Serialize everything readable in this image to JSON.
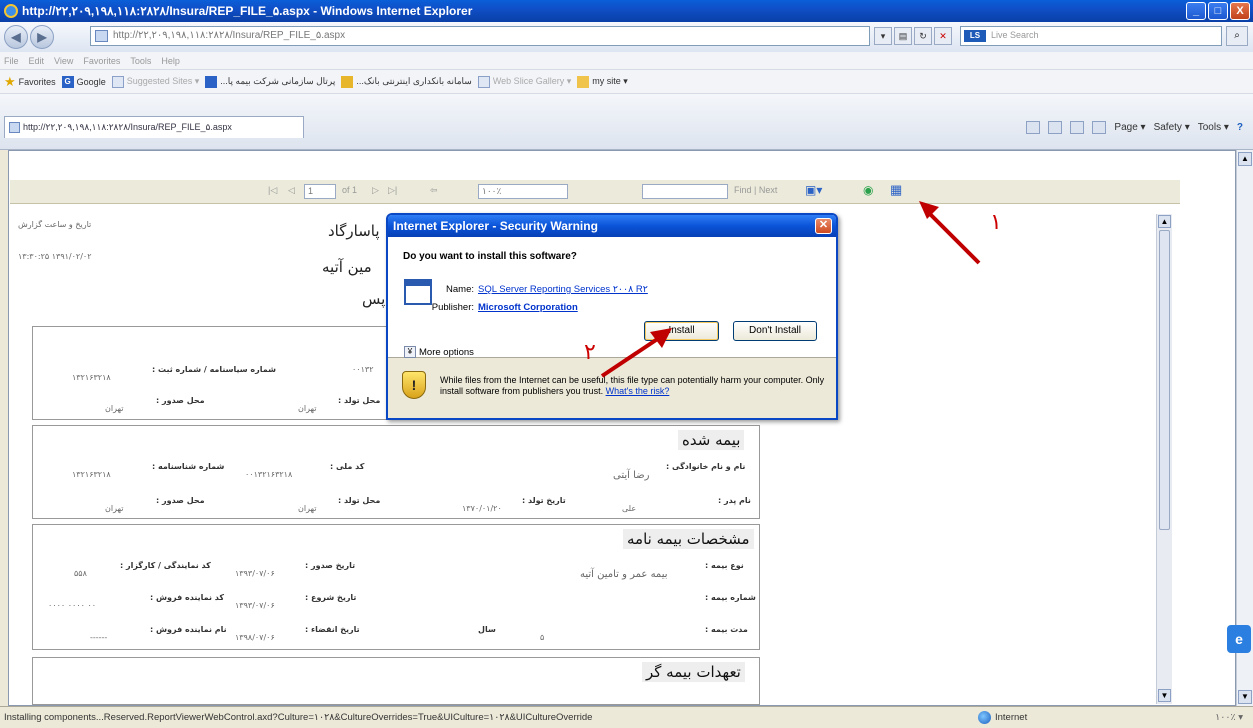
{
  "window": {
    "title": "http://۲۲,۲۰۹,۱۹۸,۱۱۸:۲۸۲۸/Insura/REP_FILE_۵.aspx - Windows Internet Explorer",
    "minimize": "_",
    "maximize": "□",
    "close": "X"
  },
  "address": {
    "url": "http://۲۲,۲۰۹,۱۹۸,۱۱۸:۲۸۲۸/Insura/REP_FILE_۵.aspx",
    "search_placeholder": "Live Search",
    "search_logo": "LS"
  },
  "menu": [
    "File",
    "Edit",
    "View",
    "Favorites",
    "Tools",
    "Help"
  ],
  "favorites": {
    "label": "Favorites",
    "items": [
      {
        "label": "Google",
        "dim": false
      },
      {
        "label": "Suggested Sites ▾",
        "dim": true
      },
      {
        "label": "...پرتال سازمانی شرکت بیمه پا",
        "dim": false
      },
      {
        "label": "...سامانه بانکداری اینترنتی بانک",
        "dim": false
      },
      {
        "label": "Web Slice Gallery ▾",
        "dim": true
      },
      {
        "label": "my site ▾",
        "dim": false
      }
    ]
  },
  "tab": {
    "label": "http://۲۲,۲۰۹,۱۹۸,۱۱۸:۲۸۲۸/Insura/REP_FILE_۵.aspx"
  },
  "commandbar": {
    "page": "Page ▾",
    "safety": "Safety ▾",
    "tools": "Tools ▾",
    "help": "?"
  },
  "report_toolbar": {
    "first": "|◁",
    "prev": "◁",
    "page_value": "1",
    "of_label": "of 1",
    "next": "▷",
    "last": "▷|",
    "back": "⇦",
    "zoom": "۱۰۰٪",
    "find_label": "Find | Next"
  },
  "report": {
    "header_left_label": "تاریخ و ساعت گزارش",
    "header_left_value": "۱۳۹۱/۰۲/۰۲ ۱۳:۳۰:۲۵",
    "org_line1": "پاسارگاد",
    "org_line2": "مین آتیه",
    "org_line3": "پس",
    "block1": {
      "label1": "شماره سیاسنامه / شماره ثبت :",
      "value1": "۱۳۲۱۶۳۲۱۸",
      "value_mid": "۰۰۱۳۲",
      "label2": "محل صدور :",
      "value2": "تهران",
      "label3": "محل تولد :",
      "value3": "تهران"
    },
    "insured": {
      "title": "بیمه شده",
      "national_code_label": "کد ملی :",
      "national_code": "۰۰۱۳۲۱۶۳۲۱۸",
      "id_label": "شماره شناسنامه :",
      "id_value": "۱۳۲۱۶۳۲۱۸",
      "name_label": "نام و نام خانوادگی :",
      "name_value": "رضا آیتی",
      "father_label": "نام پدر :",
      "father_value": "علی",
      "birth_date_label": "تاریخ تولد :",
      "birth_date": "۱۳۷۰/۰۱/۲۰",
      "birth_place_label": "محل تولد :",
      "birth_place": "تهران",
      "issue_place_label": "محل صدور :",
      "issue_place": "تهران"
    },
    "policy": {
      "title": "مشخصات بیمه نامه",
      "type_label": "نوع بیمه :",
      "type_value": "بیمه عمر و تامین آتیه",
      "number_label": "شماره بیمه :",
      "duration_label": "مدت بیمه :",
      "duration_value": "۵",
      "duration_unit": "سال",
      "issue_label": "تاریخ صدور :",
      "issue_value": "۱۳۹۳/۰۷/۰۶",
      "start_label": "تاریخ شروع :",
      "start_value": "۱۳۹۳/۰۷/۰۶",
      "end_label": "تاریخ انقضاء :",
      "end_value": "۱۳۹۸/۰۷/۰۶",
      "agent_code_label": "کد نمایندگی / کارگزار :",
      "agent_code": "۵۵۸",
      "seller_code_label": "کد نماینده فروش :",
      "seller_code": "۰۰ ۰۰۰۰ ۰۰۰۰",
      "seller_name_label": "نام نماینده فروش :",
      "seller_name": "------"
    },
    "obligations": {
      "title": "تعهدات بیمه گر"
    }
  },
  "dialog": {
    "title": "Internet Explorer - Security Warning",
    "question": "Do you want to install this software?",
    "name_label": "Name:",
    "name_value": "SQL Server Reporting Services ۲۰۰۸ R۲",
    "publisher_label": "Publisher:",
    "publisher_value": "Microsoft Corporation",
    "more_options": "More options",
    "install": "Install",
    "dont_install": "Don't Install",
    "warning_text": "While files from the Internet can be useful, this file type can potentially harm your computer. Only install software from publishers you trust.",
    "risk_link": "What's the risk?"
  },
  "annotations": {
    "one": "۱",
    "two": "۲"
  },
  "status": {
    "message": "Installing components...Reserved.ReportViewerWebControl.axd?Culture=۱۰۲۸&CultureOverrides=True&UICulture=۱۰۲۸&UICultureOverride",
    "zone": "Internet",
    "zoom": "۱۰۰٪ ▾"
  },
  "colors": {
    "accent": "#0a47c5",
    "annotation": "#c00000",
    "toolbar": "#ecebdb"
  }
}
